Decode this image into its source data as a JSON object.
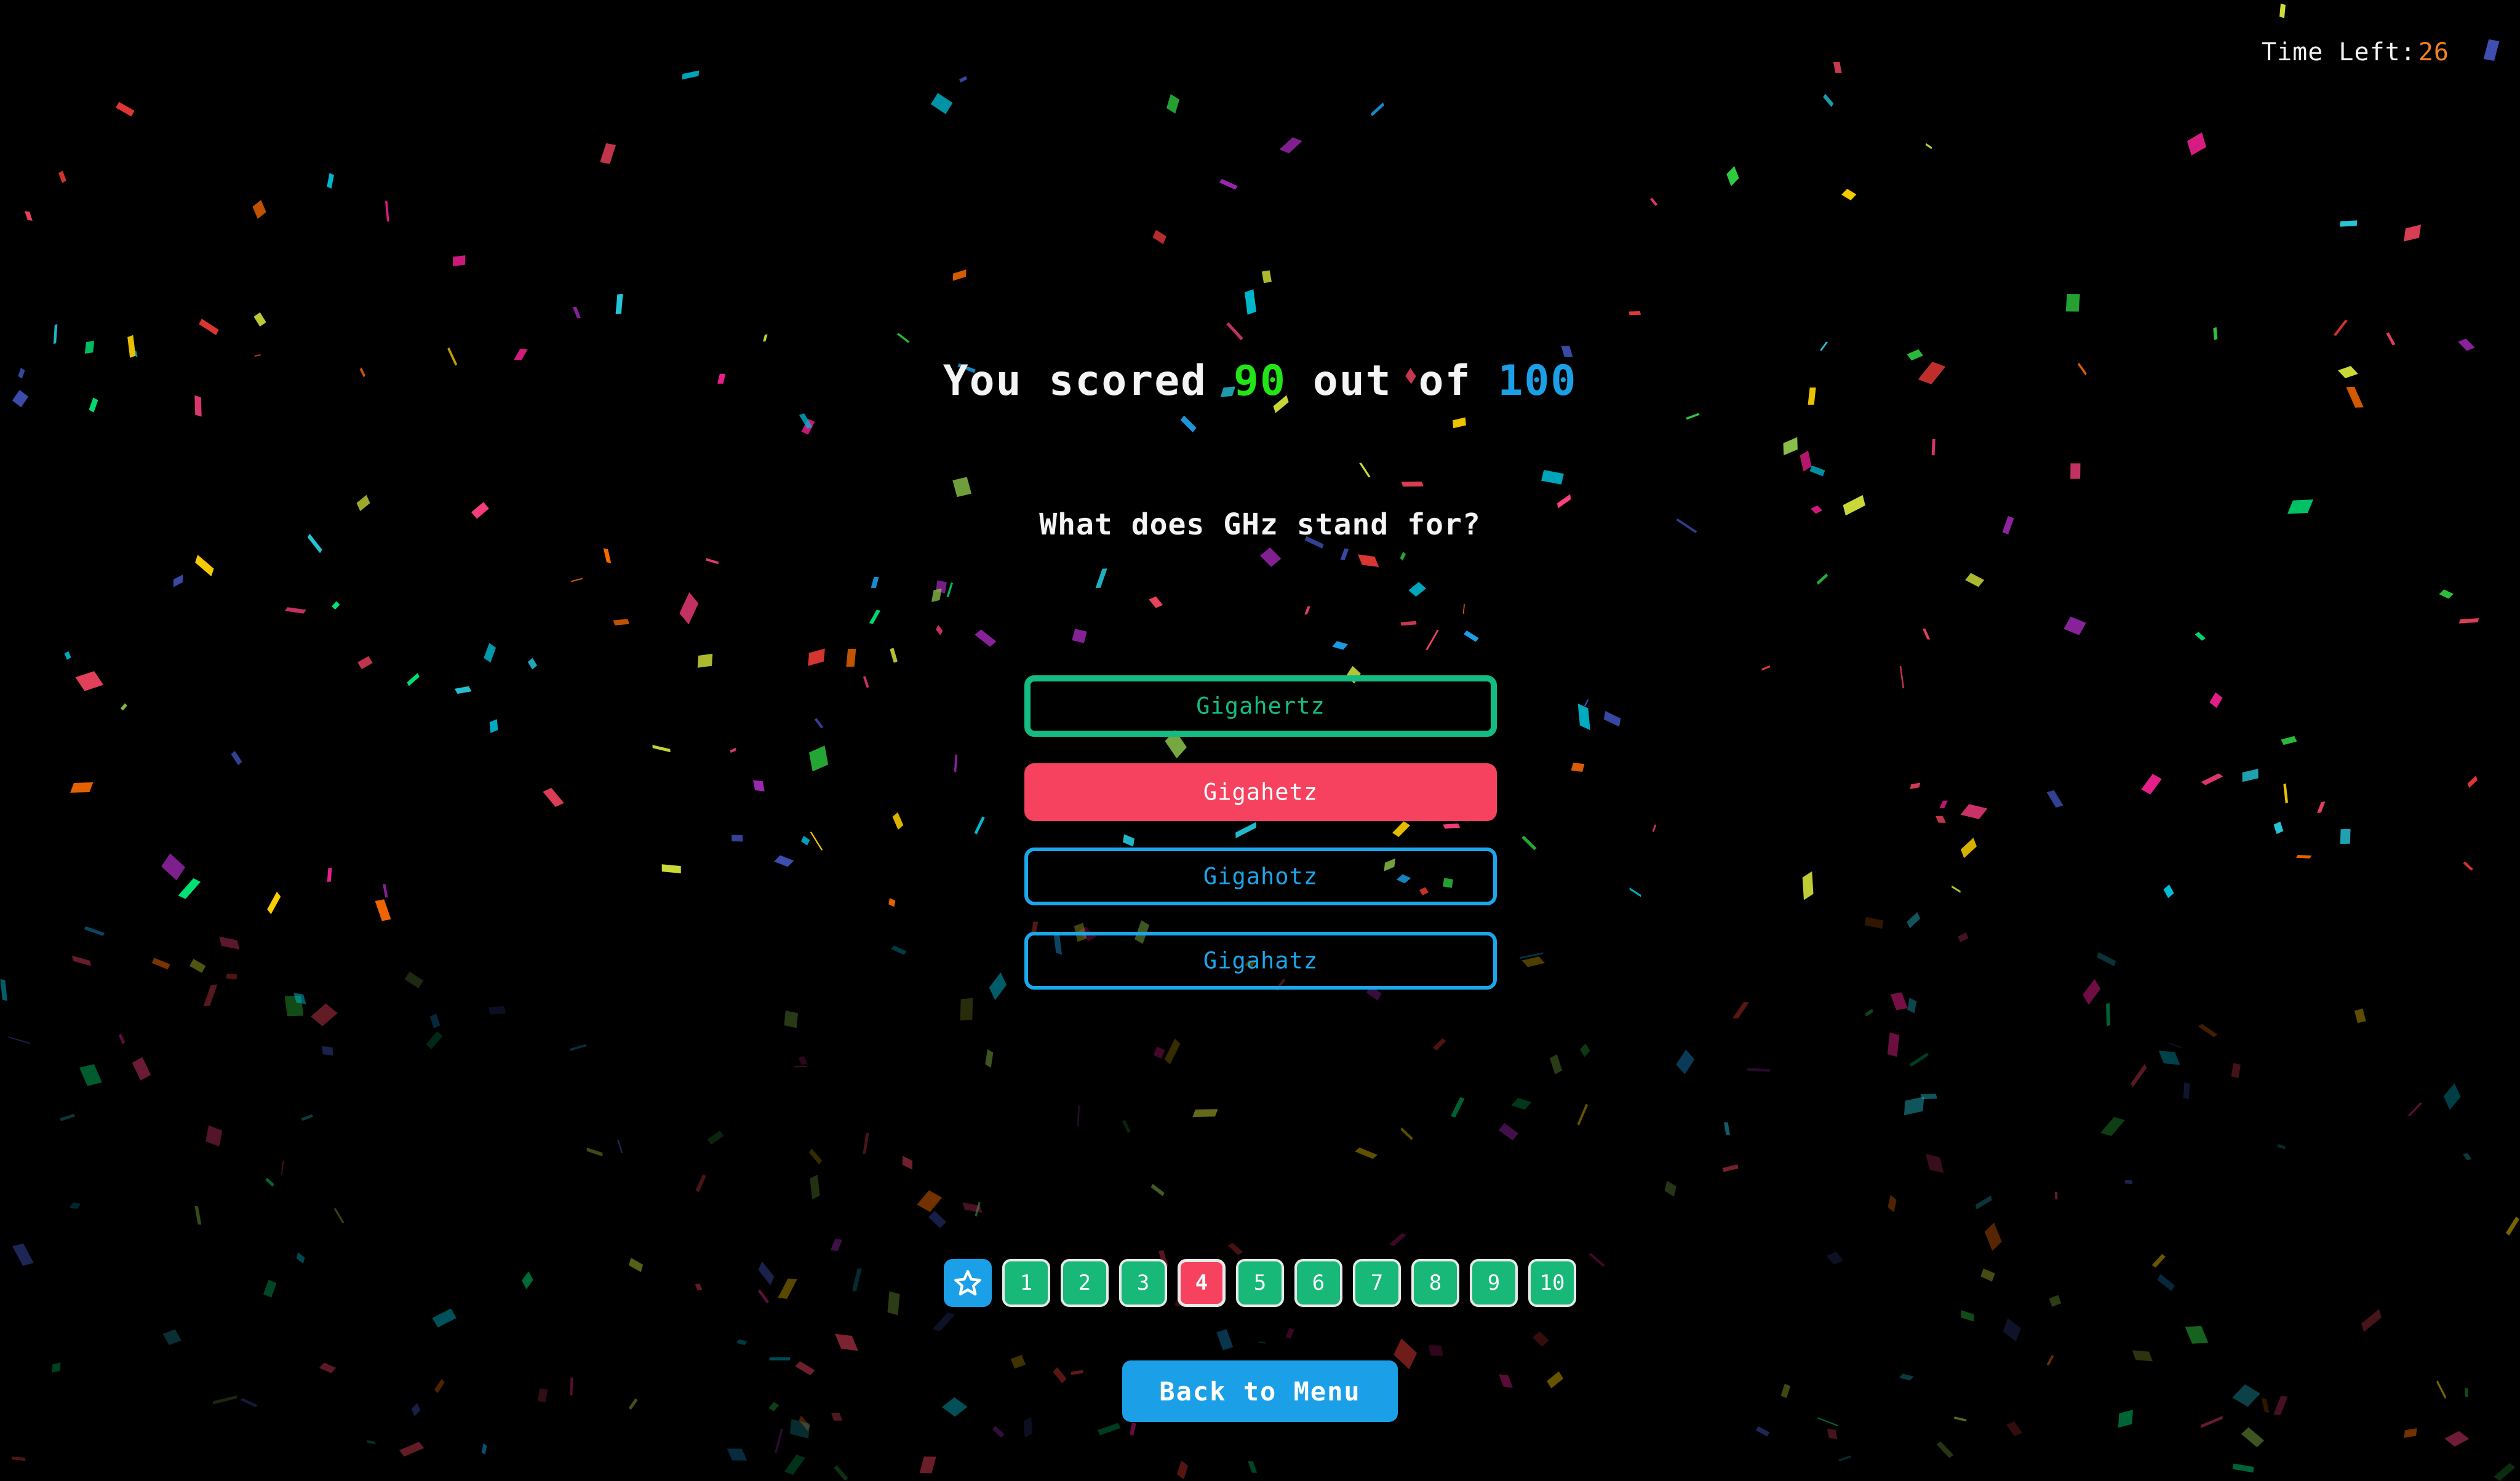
{
  "app": {
    "background_color": "#000000",
    "celebration": "confetti"
  },
  "timer": {
    "label": "Time Left:",
    "value": "26",
    "value_color": "#f5821f",
    "label_color": "#f2f2f2"
  },
  "result": {
    "prefix": "You scored",
    "score": "90",
    "middle": "out of",
    "total": "100",
    "score_color": "#21e516",
    "total_color": "#1ba0e8"
  },
  "question": {
    "text": "What does GHz stand for?",
    "number": 4,
    "options": [
      {
        "label": "Gigahertz",
        "state": "correct",
        "color": "#15bc82"
      },
      {
        "label": "Gigahetz",
        "state": "selected-wrong",
        "color": "#f6425f"
      },
      {
        "label": "Gigahotz",
        "state": "neutral",
        "color": "#1ca7ec"
      },
      {
        "label": "Gigahatz",
        "state": "neutral",
        "color": "#1ca7ec"
      }
    ]
  },
  "question_nav": {
    "summary_icon": "star-outline-icon",
    "summary_color": "#1ba0e8",
    "items": [
      {
        "label": "1",
        "state": "answered-correct"
      },
      {
        "label": "2",
        "state": "answered-correct"
      },
      {
        "label": "3",
        "state": "answered-correct"
      },
      {
        "label": "4",
        "state": "current-wrong"
      },
      {
        "label": "5",
        "state": "answered-correct"
      },
      {
        "label": "6",
        "state": "answered-correct"
      },
      {
        "label": "7",
        "state": "answered-correct"
      },
      {
        "label": "8",
        "state": "answered-correct"
      },
      {
        "label": "9",
        "state": "answered-correct"
      },
      {
        "label": "10",
        "state": "answered-correct"
      }
    ],
    "correct_color": "#18b878",
    "wrong_color": "#f6425f"
  },
  "footer": {
    "back_label": "Back to Menu",
    "back_color": "#1ba0e8"
  },
  "confetti": {
    "palette": [
      "#26c6da",
      "#e91e8c",
      "#ffd200",
      "#e53935",
      "#2ecc40",
      "#1ba0e8",
      "#9c27b0",
      "#00e676",
      "#ff6d00",
      "#f5455f",
      "#8bc34a",
      "#3f51b5",
      "#00bcd4",
      "#cddc39",
      "#ff4081"
    ],
    "count": 420
  }
}
